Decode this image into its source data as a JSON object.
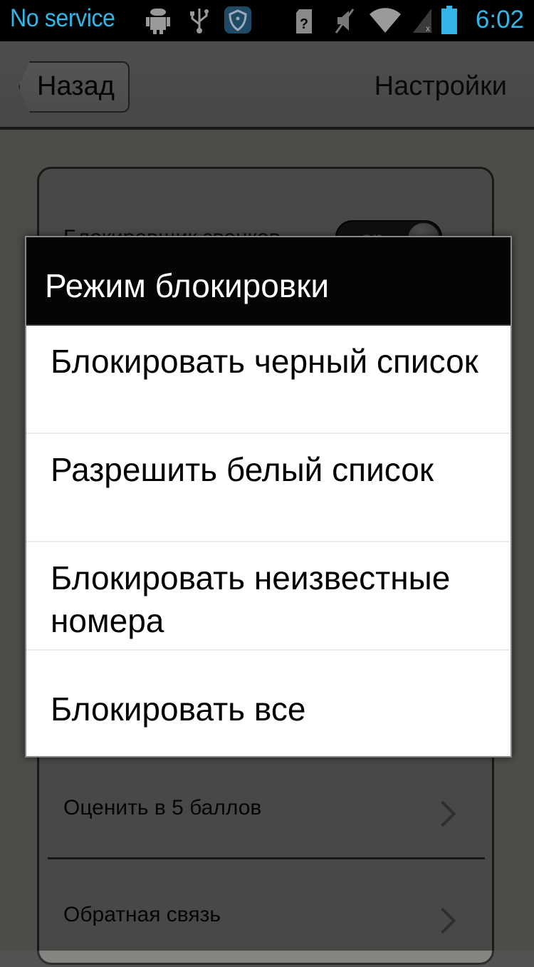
{
  "status_bar": {
    "carrier": "No service",
    "time": "6:02",
    "icons": [
      "android-debug-icon",
      "usb-icon",
      "shield-app-icon",
      "sim-unknown-icon",
      "mute-icon",
      "wifi-icon",
      "signal-none-icon",
      "battery-icon"
    ],
    "accent_color": "#33b5e5"
  },
  "action_bar": {
    "back_label": "Назад",
    "title": "Настройки"
  },
  "settings": {
    "call_blocker_label": "Блокировщик звонков",
    "call_blocker_toggle": "on",
    "rate_label": "Оценить в 5 баллов",
    "feedback_label": "Обратная связь"
  },
  "dialog": {
    "title": "Режим блокировки",
    "options": [
      {
        "label": "Блокировать черный список"
      },
      {
        "label": "Разрешить белый список"
      },
      {
        "label": "Блокировать неизвестные номера"
      },
      {
        "label": "Блокировать все"
      }
    ]
  }
}
